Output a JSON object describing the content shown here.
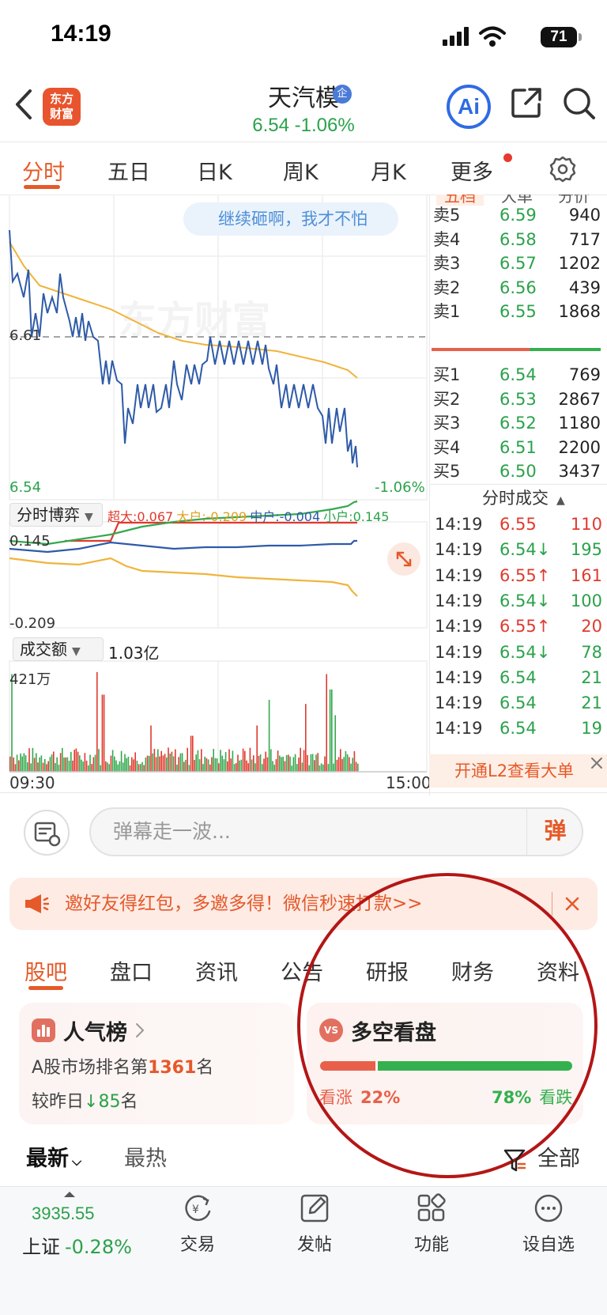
{
  "status_bar": {
    "time": "14:19",
    "battery": "71"
  },
  "header": {
    "logo_line1": "东方",
    "logo_line2": "财富",
    "stock_name": "天汽模",
    "badge": "企",
    "price_change": "6.54  -1.06%",
    "ai_label": "Ai"
  },
  "period_tabs": [
    "分时",
    "五日",
    "日K",
    "周K",
    "月K",
    "更多"
  ],
  "chart": {
    "bubble": "继续砸啊，我才不怕",
    "watermark": "东方财富",
    "ref_price": "6.61",
    "bottom_price": "6.54",
    "bottom_pct": "-1.06%",
    "time_start": "09:30",
    "time_end": "15:00"
  },
  "game": {
    "select_label": "分时博弈",
    "super": "超大:0.067",
    "big": "大户:-0.209",
    "mid": "中户:-0.004",
    "small": "小户:0.145",
    "top_val": "0.145",
    "bottom_val": "-0.209"
  },
  "volume": {
    "select_label": "成交额",
    "total": "1.03亿",
    "max_label": "421万"
  },
  "order_book": {
    "header": [
      "五档",
      "大单",
      "分价"
    ],
    "sells": [
      {
        "label": "卖5",
        "price": "6.59",
        "vol": "940"
      },
      {
        "label": "卖4",
        "price": "6.58",
        "vol": "717"
      },
      {
        "label": "卖3",
        "price": "6.57",
        "vol": "1202"
      },
      {
        "label": "卖2",
        "price": "6.56",
        "vol": "439"
      },
      {
        "label": "卖1",
        "price": "6.55",
        "vol": "1868"
      }
    ],
    "buys": [
      {
        "label": "买1",
        "price": "6.54",
        "vol": "769"
      },
      {
        "label": "买2",
        "price": "6.53",
        "vol": "2867"
      },
      {
        "label": "买3",
        "price": "6.52",
        "vol": "1180"
      },
      {
        "label": "买4",
        "price": "6.51",
        "vol": "2200"
      },
      {
        "label": "买5",
        "price": "6.50",
        "vol": "3437"
      }
    ]
  },
  "trades": {
    "title": "分时成交",
    "rows": [
      {
        "time": "14:19",
        "price": "6.55",
        "vol": "110",
        "dir": "red"
      },
      {
        "time": "14:19",
        "price": "6.54↓",
        "vol": "195",
        "dir": "green"
      },
      {
        "time": "14:19",
        "price": "6.55↑",
        "vol": "161",
        "dir": "red"
      },
      {
        "time": "14:19",
        "price": "6.54↓",
        "vol": "100",
        "dir": "green"
      },
      {
        "time": "14:19",
        "price": "6.55↑",
        "vol": "20",
        "dir": "red"
      },
      {
        "time": "14:19",
        "price": "6.54↓",
        "vol": "78",
        "dir": "green"
      },
      {
        "time": "14:19",
        "price": "6.54",
        "vol": "21",
        "dir": "green"
      },
      {
        "time": "14:19",
        "price": "6.54",
        "vol": "21",
        "dir": "green"
      },
      {
        "time": "14:19",
        "price": "6.54",
        "vol": "19",
        "dir": "green"
      }
    ],
    "l2_banner": "开通L2查看大单"
  },
  "danmu": {
    "placeholder": "弹幕走一波...",
    "send": "弹"
  },
  "promo": {
    "text": "邀好友得红包，多邀多得！微信秒速打款>>"
  },
  "section_tabs": [
    "股吧",
    "盘口",
    "资讯",
    "公告",
    "研报",
    "财务",
    "资料"
  ],
  "popularity": {
    "title": "人气榜",
    "rank_prefix": "A股市场排名第",
    "rank": "1361",
    "rank_suffix": "名",
    "change_prefix": "较昨日",
    "change": "85",
    "change_suffix": "名"
  },
  "sentiment": {
    "title": "多空看盘",
    "bull_label": "看涨",
    "bull_pct": "22%",
    "bear_pct": "78%",
    "bear_label": "看跌",
    "bull_ratio": 0.22
  },
  "sort": {
    "latest": "最新",
    "hot": "最热",
    "filter": "全部"
  },
  "bottom_nav": {
    "index_value": "3935.55",
    "index_name": "上证",
    "index_pct": "-0.28%",
    "items": [
      "交易",
      "发帖",
      "功能",
      "设自选"
    ]
  },
  "colors": {
    "accent": "#e55a28",
    "up": "#e03a2e",
    "down": "#2aa24a",
    "price_line": "#2e5aa8",
    "avg_line": "#f0b43c"
  }
}
